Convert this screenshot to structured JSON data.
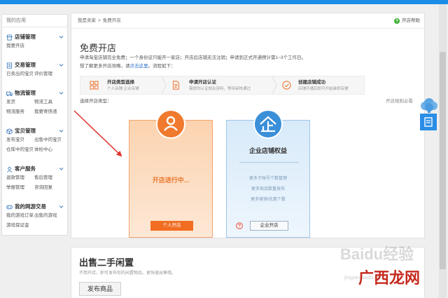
{
  "topbar": {
    "color": "#1a8ee6"
  },
  "sidebar": {
    "title": "我的应用",
    "sections": [
      {
        "title": "店铺管理",
        "icon": "shop-icon",
        "links": [
          "我要开店"
        ]
      },
      {
        "title": "交易管理",
        "icon": "trade-icon",
        "links": [
          "已卖出的宝贝",
          "评价管理"
        ]
      },
      {
        "title": "物流管理",
        "icon": "logistics-icon",
        "links": [
          "发货",
          "物流工具",
          "物流服务",
          "我要寄快递"
        ]
      },
      {
        "title": "宝贝管理",
        "icon": "goods-icon",
        "links": [
          "发布宝贝",
          "出售中的宝贝",
          "仓库中的宝贝",
          "体检中心"
        ]
      },
      {
        "title": "客户服务",
        "icon": "customer-service-icon",
        "links": [
          "退款管理",
          "售后管理",
          "举报管理",
          "咨询回复"
        ]
      },
      {
        "title": "我的网游交易",
        "icon": "game-icon",
        "links": [
          "我的游戏订单",
          "出售的游戏",
          "游戏保证金"
        ]
      }
    ]
  },
  "breadcrumb": {
    "items": [
      "我是卖家",
      "免费开店"
    ],
    "separator": ">"
  },
  "help": {
    "label": "开店帮助",
    "icon": "help-icon",
    "color": "#3cb034"
  },
  "open_shop": {
    "title": "免费开店",
    "notice": "申请淘宝店铺完全免费；一个身份证只能开一家店；开店后店铺无法注销；申请到正式开通预计需1~3个工作日。",
    "guide_prefix": "想了解更多开店攻略，请",
    "guide_link": "点击这里",
    "guide_suffix": "。流程如下：",
    "steps": [
      {
        "title": "开店类型选择",
        "desc": "个人店铺  企业店铺",
        "icon": "grid-icon"
      },
      {
        "title": "申请开店认证",
        "desc": "需提供认证相关资料，等待审核通过",
        "icon": "document-icon"
      },
      {
        "title": "创建店铺成功",
        "desc": "店铺开通后即可开始装修店铺",
        "icon": "check-circle-icon"
      }
    ],
    "choose_label": "选择开店类型：",
    "rules_link": "开店规则必看",
    "personal": {
      "status": "开店进行中...",
      "button": "个人开店",
      "icon": "person-icon",
      "color": "#f07a2e"
    },
    "enterprise": {
      "title": "企业店铺权益",
      "benefits": [
        "更多子账号个数管理",
        "更多商品数量发布",
        "更多营销/优惠个数"
      ],
      "button": "企业开店",
      "icon": "enterprise-icon",
      "color": "#3a8fd8"
    }
  },
  "secondhand": {
    "title": "出售二手闲置",
    "desc": "不用开店，即可发布你的闲置物品，更快速出售哦。",
    "button": "发布商品"
  },
  "float_widget": {
    "icons": [
      "cloud-icon",
      "feedback-icon"
    ]
  },
  "watermark": {
    "brand": "Baidu经验",
    "url": "jingyan.baidu.com",
    "site": "广西龙网"
  }
}
